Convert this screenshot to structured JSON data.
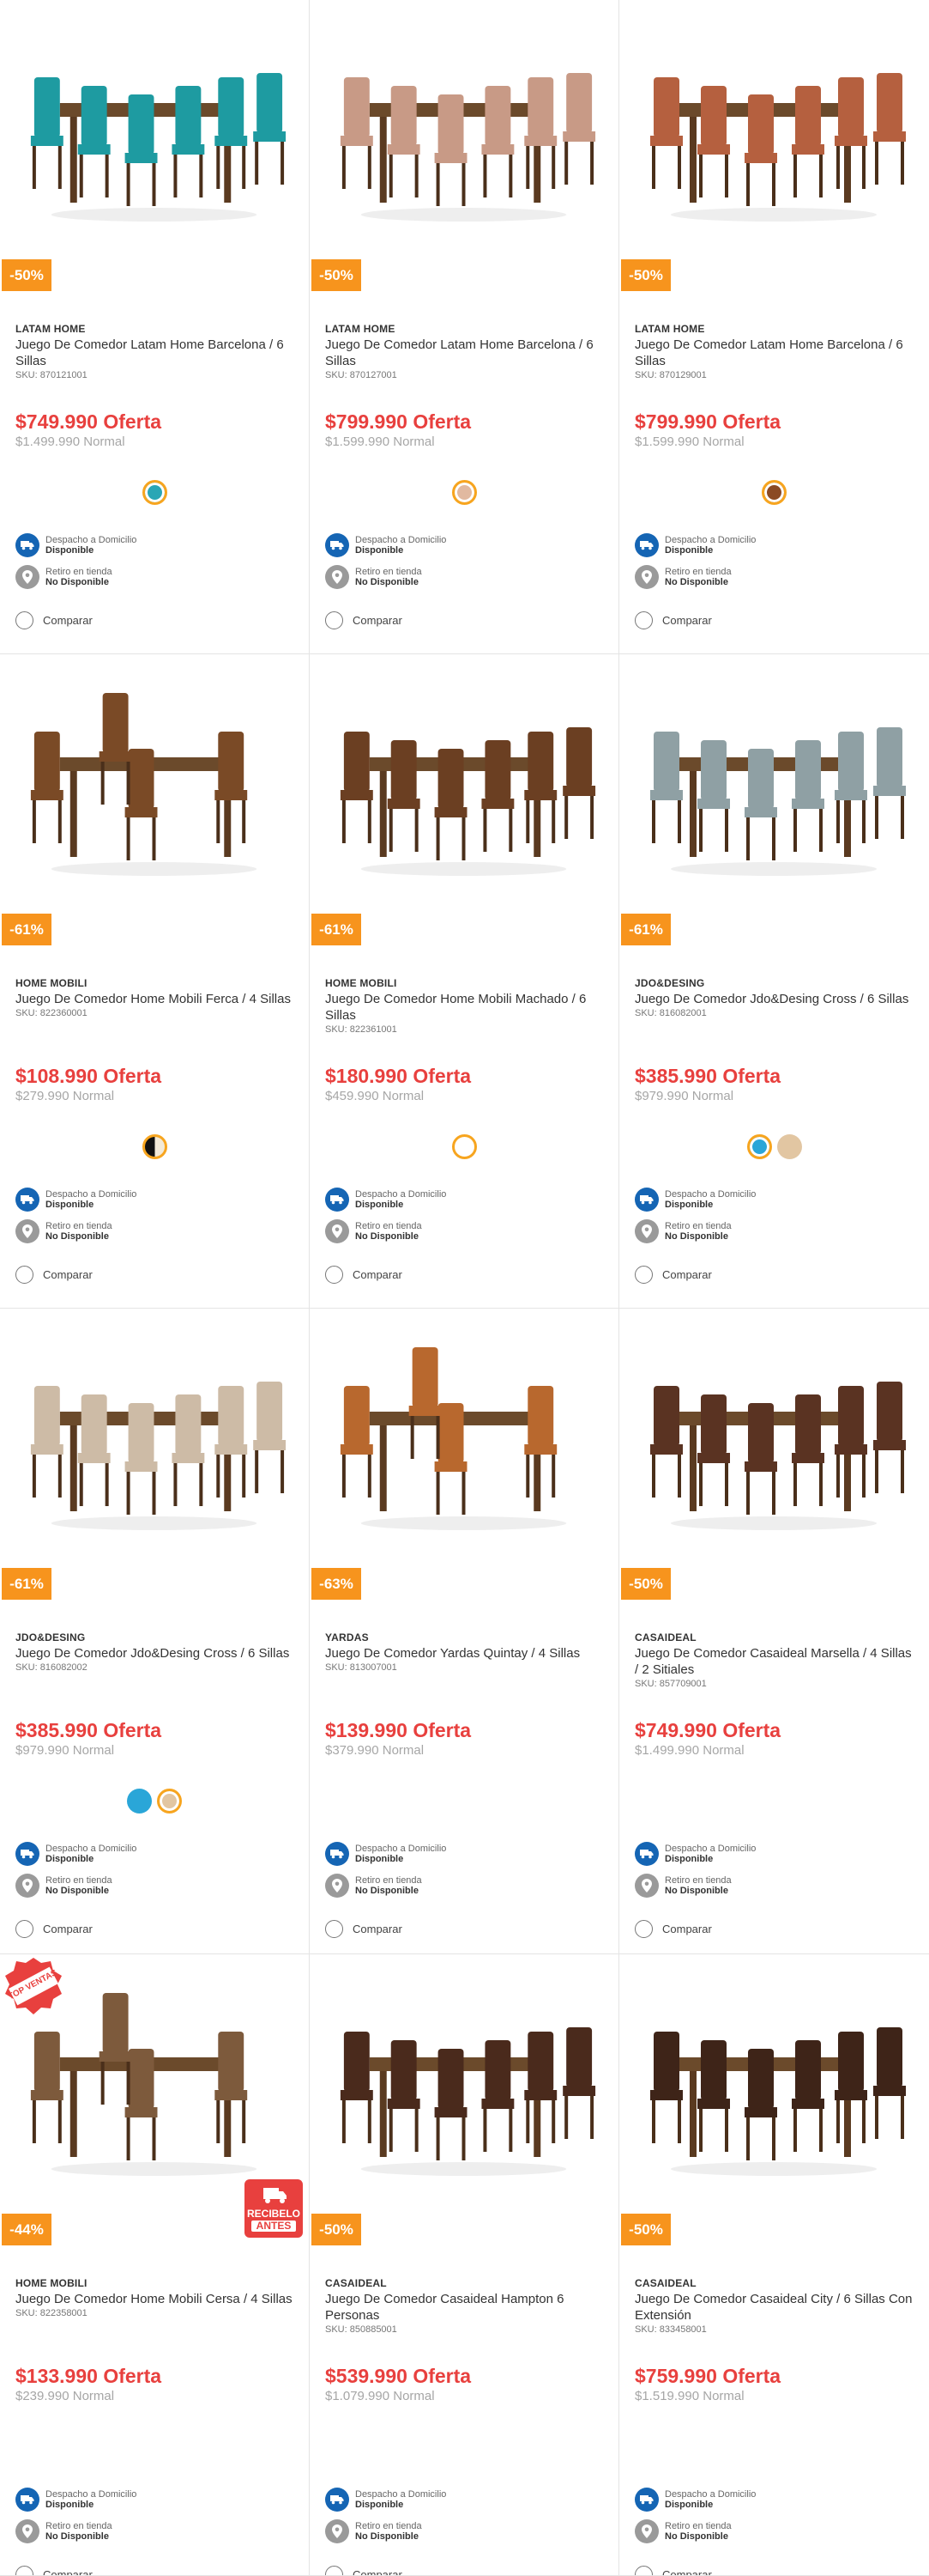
{
  "compare_label": "Comparar",
  "delivery": {
    "home_title": "Despacho a Domicilio",
    "home_status": "Disponible",
    "store_title": "Retiro en tienda",
    "store_status": "No Disponible"
  },
  "badges": {
    "top_ventas": "TOP VENTAS",
    "recibelo_line1": "RECIBELO",
    "recibelo_line2": "ANTES"
  },
  "products": [
    {
      "discount": "-50%",
      "brand": "LATAM HOME",
      "name": "Juego De Comedor Latam Home Barcelona / 6 Sillas",
      "sku": "SKU: 870121001",
      "offer": "$749.990 Oferta",
      "normal": "$1.499.990 Normal",
      "chair_color": "#1e9ba1",
      "swatches": [
        {
          "color": "#2aa6b5",
          "selected": true
        }
      ]
    },
    {
      "discount": "-50%",
      "brand": "LATAM HOME",
      "name": "Juego De Comedor Latam Home Barcelona / 6 Sillas",
      "sku": "SKU: 870127001",
      "offer": "$799.990 Oferta",
      "normal": "$1.599.990 Normal",
      "chair_color": "#c89a86",
      "swatches": [
        {
          "color": "#e1b9a0",
          "selected": true
        }
      ]
    },
    {
      "discount": "-50%",
      "brand": "LATAM HOME",
      "name": "Juego De Comedor Latam Home Barcelona / 6 Sillas",
      "sku": "SKU: 870129001",
      "offer": "$799.990 Oferta",
      "normal": "$1.599.990 Normal",
      "chair_color": "#b5603f",
      "swatches": [
        {
          "color": "#8b4a24",
          "selected": true
        }
      ]
    },
    {
      "discount": "-61%",
      "brand": "HOME MOBILI",
      "name": "Juego De Comedor Home Mobili Ferca / 4 Sillas",
      "sku": "SKU: 822360001",
      "offer": "$108.990 Oferta",
      "normal": "$279.990 Normal",
      "chair_color": "#7a4a26",
      "swatches": [
        {
          "color": "half",
          "selected": true
        }
      ]
    },
    {
      "discount": "-61%",
      "brand": "HOME MOBILI",
      "name": "Juego De Comedor Home Mobili Machado / 6 Sillas",
      "sku": "SKU: 822361001",
      "offer": "$180.990 Oferta",
      "normal": "$459.990 Normal",
      "chair_color": "#6b3f22",
      "swatches": [
        {
          "color": "#ffffff",
          "selected": true
        }
      ]
    },
    {
      "discount": "-61%",
      "brand": "JDO&DESING",
      "name": "Juego De Comedor Jdo&Desing Cross / 6 Sillas",
      "sku": "SKU: 816082001",
      "offer": "$385.990 Oferta",
      "normal": "$979.990 Normal",
      "chair_color": "#8fa0a4",
      "swatches": [
        {
          "color": "#2aa6d8",
          "selected": true
        },
        {
          "color": "#e2c6a2",
          "selected": false
        }
      ]
    },
    {
      "discount": "-61%",
      "brand": "JDO&DESING",
      "name": "Juego De Comedor Jdo&Desing Cross / 6 Sillas",
      "sku": "SKU: 816082002",
      "offer": "$385.990 Oferta",
      "normal": "$979.990 Normal",
      "chair_color": "#cdbba6",
      "swatches": [
        {
          "color": "#2aa6d8",
          "selected": false
        },
        {
          "color": "#e2c6a2",
          "selected": true
        }
      ]
    },
    {
      "discount": "-63%",
      "brand": "YARDAS",
      "name": "Juego De Comedor Yardas Quintay / 4 Sillas",
      "sku": "SKU: 813007001",
      "offer": "$139.990 Oferta",
      "normal": "$379.990 Normal",
      "chair_color": "#b8682e",
      "swatches": []
    },
    {
      "discount": "-50%",
      "brand": "CASAIDEAL",
      "name": "Juego De Comedor Casaideal Marsella / 4 Sillas / 2 Sitiales",
      "sku": "SKU: 857709001",
      "offer": "$749.990 Oferta",
      "normal": "$1.499.990 Normal",
      "chair_color": "#5a3322",
      "swatches": []
    },
    {
      "discount": "-44%",
      "brand": "HOME MOBILI",
      "name": "Juego De Comedor Home Mobili Cersa / 4 Sillas",
      "sku": "SKU: 822358001",
      "offer": "$133.990 Oferta",
      "normal": "$239.990 Normal",
      "chair_color": "#7d5a3c",
      "swatches": []
    },
    {
      "discount": "-50%",
      "brand": "CASAIDEAL",
      "name": "Juego De Comedor Casaideal Hampton 6 Personas",
      "sku": "SKU: 850885001",
      "offer": "$539.990 Oferta",
      "normal": "$1.079.990 Normal",
      "chair_color": "#4a2a1c",
      "swatches": []
    },
    {
      "discount": "-50%",
      "brand": "CASAIDEAL",
      "name": "Juego De Comedor Casaideal City / 6 Sillas Con Extensión",
      "sku": "SKU: 833458001",
      "offer": "$759.990 Oferta",
      "normal": "$1.519.990 Normal",
      "chair_color": "#3e2418",
      "swatches": []
    }
  ]
}
